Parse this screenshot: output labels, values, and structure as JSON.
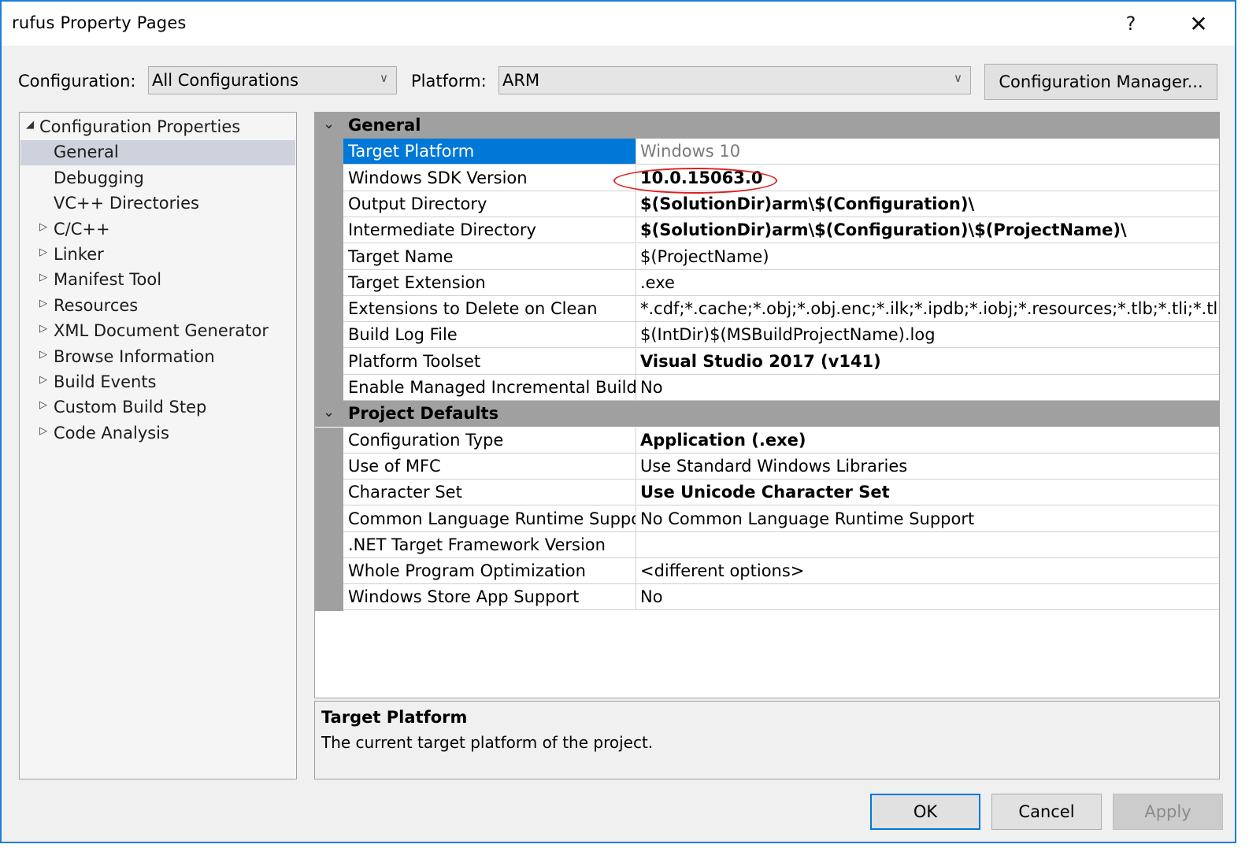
{
  "window": {
    "title": "rufus Property Pages",
    "help_label": "?",
    "close_label": "✕"
  },
  "toolbar": {
    "configuration_label": "Configuration:",
    "configuration_value": "All Configurations",
    "platform_label": "Platform:",
    "platform_value": "ARM",
    "chevron": "∨",
    "config_manager_label": "Configuration Manager..."
  },
  "tree": {
    "root": {
      "label": "Configuration Properties",
      "expanded": true,
      "arrow": "◢"
    },
    "items": [
      {
        "label": "General",
        "selected": true,
        "expandable": false
      },
      {
        "label": "Debugging",
        "expandable": false
      },
      {
        "label": "VC++ Directories",
        "expandable": false
      },
      {
        "label": "C/C++",
        "expandable": true
      },
      {
        "label": "Linker",
        "expandable": true
      },
      {
        "label": "Manifest Tool",
        "expandable": true
      },
      {
        "label": "Resources",
        "expandable": true
      },
      {
        "label": "XML Document Generator",
        "expandable": true
      },
      {
        "label": "Browse Information",
        "expandable": true
      },
      {
        "label": "Build Events",
        "expandable": true
      },
      {
        "label": "Custom Build Step",
        "expandable": true
      },
      {
        "label": "Code Analysis",
        "expandable": true
      }
    ],
    "collapsed_arrow": "▷"
  },
  "grid": {
    "categories": [
      {
        "label": "General",
        "chevron": "⌄",
        "rows": [
          {
            "name": "Target Platform",
            "value": "Windows 10",
            "style": "gray",
            "selected": true
          },
          {
            "name": "Windows SDK Version",
            "value": "10.0.15063.0",
            "style": "bold",
            "highlighted": true
          },
          {
            "name": "Output Directory",
            "value": "$(SolutionDir)arm\\$(Configuration)\\",
            "style": "bold"
          },
          {
            "name": "Intermediate Directory",
            "value": "$(SolutionDir)arm\\$(Configuration)\\$(ProjectName)\\",
            "style": "bold"
          },
          {
            "name": "Target Name",
            "value": "$(ProjectName)",
            "style": "normal"
          },
          {
            "name": "Target Extension",
            "value": ".exe",
            "style": "normal"
          },
          {
            "name": "Extensions to Delete on Clean",
            "value": "*.cdf;*.cache;*.obj;*.obj.enc;*.ilk;*.ipdb;*.iobj;*.resources;*.tlb;*.tli;*.tlh;*.tmp;",
            "style": "normal"
          },
          {
            "name": "Build Log File",
            "value": "$(IntDir)$(MSBuildProjectName).log",
            "style": "normal"
          },
          {
            "name": "Platform Toolset",
            "value": "Visual Studio 2017 (v141)",
            "style": "bold"
          },
          {
            "name": "Enable Managed Incremental Build",
            "value": "No",
            "style": "normal"
          }
        ]
      },
      {
        "label": "Project Defaults",
        "chevron": "⌄",
        "rows": [
          {
            "name": "Configuration Type",
            "value": "Application (.exe)",
            "style": "bold"
          },
          {
            "name": "Use of MFC",
            "value": "Use Standard Windows Libraries",
            "style": "normal"
          },
          {
            "name": "Character Set",
            "value": "Use Unicode Character Set",
            "style": "bold"
          },
          {
            "name": "Common Language Runtime Suppo",
            "value": "No Common Language Runtime Support",
            "style": "normal"
          },
          {
            "name": ".NET Target Framework Version",
            "value": "",
            "style": "normal"
          },
          {
            "name": "Whole Program Optimization",
            "value": "<different options>",
            "style": "normal"
          },
          {
            "name": "Windows Store App Support",
            "value": "No",
            "style": "normal"
          }
        ]
      }
    ]
  },
  "description": {
    "title": "Target Platform",
    "text": "The current target platform of the project."
  },
  "buttons": {
    "ok": "OK",
    "cancel": "Cancel",
    "apply": "Apply"
  },
  "colors": {
    "accent": "#0078d7",
    "window_border": "#1a7fd8",
    "annotation": "#e02020",
    "category_bg": "#a0a0a0"
  }
}
